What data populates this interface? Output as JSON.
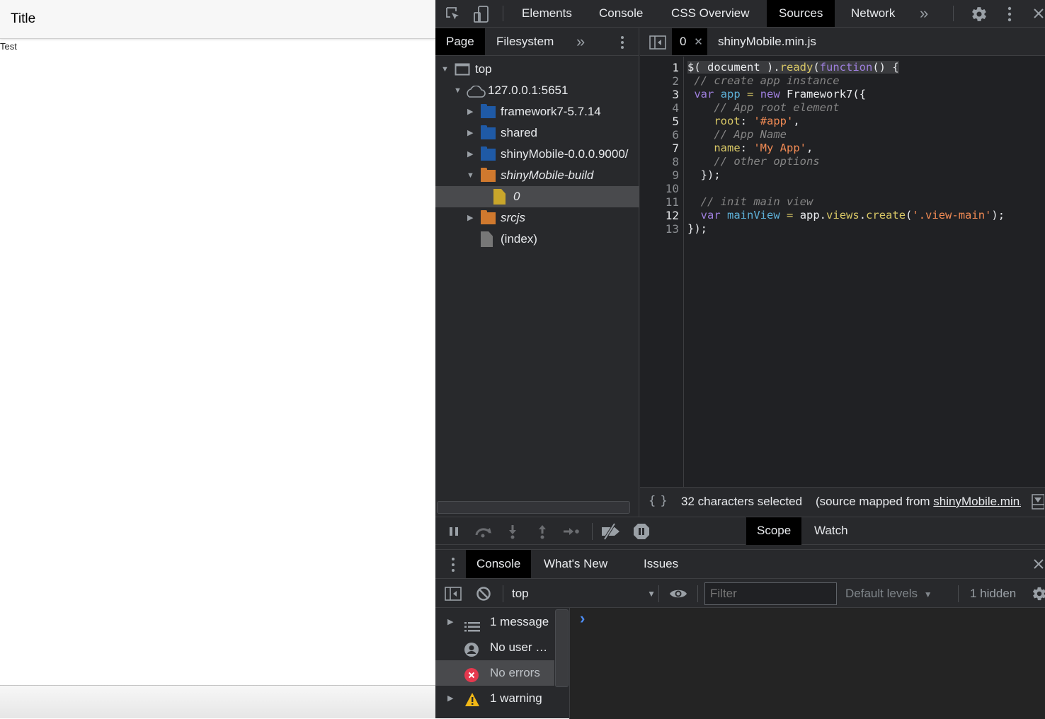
{
  "app": {
    "title": "Title",
    "content_text": "Test"
  },
  "devtools": {
    "main_tabs": [
      {
        "label": "Elements",
        "active": false
      },
      {
        "label": "Console",
        "active": false
      },
      {
        "label": "CSS Overview",
        "active": false
      },
      {
        "label": "Sources",
        "active": true
      },
      {
        "label": "Network",
        "active": false
      }
    ],
    "more_tabs_glyph": "»",
    "navigator": {
      "tabs": [
        {
          "label": "Page",
          "active": true
        },
        {
          "label": "Filesystem",
          "active": false
        }
      ],
      "more_glyph": "»",
      "tree": [
        {
          "label": "top",
          "type": "frame",
          "expanded": true
        },
        {
          "label": "127.0.0.1:5651",
          "type": "cloud",
          "expanded": true
        },
        {
          "label": "framework7-5.7.14",
          "type": "folder-blue",
          "expanded": false
        },
        {
          "label": "shared",
          "type": "folder-blue",
          "expanded": false
        },
        {
          "label": "shinyMobile-0.0.0.9000/",
          "type": "folder-blue",
          "expanded": false
        },
        {
          "label": "shinyMobile-build",
          "type": "folder-orange",
          "expanded": true
        },
        {
          "label": "0",
          "type": "file-yellow",
          "selected": true
        },
        {
          "label": "srcjs",
          "type": "folder-orange",
          "expanded": false
        },
        {
          "label": "(index)",
          "type": "file-gray"
        }
      ]
    },
    "editor": {
      "tabs": [
        {
          "label": "0",
          "active": true,
          "closable": true
        },
        {
          "label": "shinyMobile.min.js",
          "active": false
        }
      ],
      "line_numbers": [
        "1",
        "2",
        "3",
        "4",
        "5",
        "6",
        "7",
        "8",
        "9",
        "10",
        "11",
        "12",
        "13"
      ],
      "code_lines": [
        "$( document ).ready(function() {",
        " // create app instance",
        " var app = new Framework7({",
        "    // App root element",
        "    root: '#app',",
        "    // App Name",
        "    name: 'My App',",
        "    // other options",
        "  });",
        "",
        "  // init main view",
        "  var mainView = app.views.create('.view-main');",
        "});"
      ],
      "status": {
        "format_glyph": "{ }",
        "selection_text": "32 characters selected",
        "source_mapped_prefix": "(source mapped from ",
        "source_mapped_link": "shinyMobile.min.js"
      }
    },
    "debugger": {
      "tabs": [
        {
          "label": "Scope",
          "active": true
        },
        {
          "label": "Watch",
          "active": false
        }
      ]
    },
    "drawer": {
      "tabs": [
        {
          "label": "Console",
          "active": true
        },
        {
          "label": "What's New",
          "active": false
        },
        {
          "label": "Issues",
          "active": false
        }
      ],
      "context": "top",
      "filter_placeholder": "Filter",
      "levels": "Default levels",
      "hidden_count": "1 hidden",
      "sidebar": [
        {
          "label": "1 message",
          "icon": "list-icon",
          "expandable": true
        },
        {
          "label": "No user …",
          "icon": "user-icon",
          "expandable": false
        },
        {
          "label": "No errors",
          "icon": "error-icon",
          "expandable": false,
          "selected": true
        },
        {
          "label": "1 warning",
          "icon": "warning-icon",
          "expandable": true
        }
      ],
      "prompt_glyph": "›"
    }
  }
}
